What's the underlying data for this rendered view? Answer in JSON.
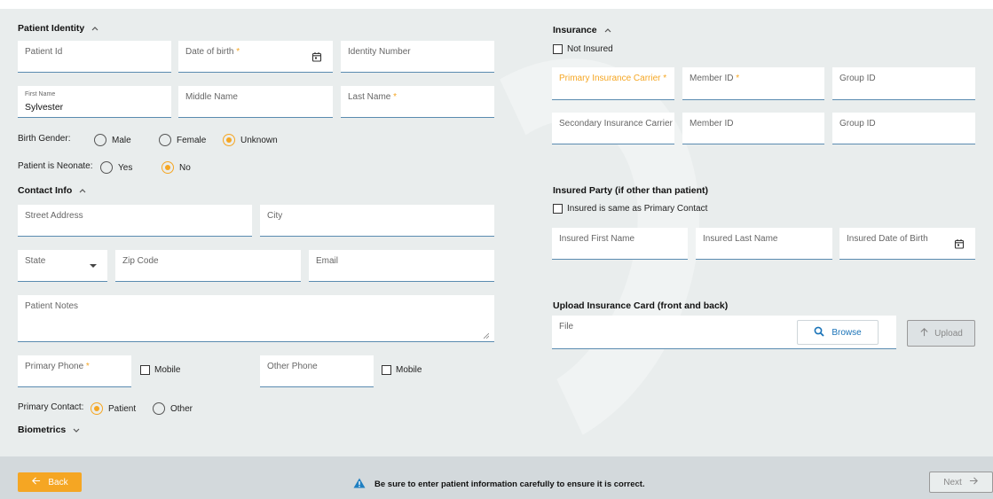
{
  "patient_identity": {
    "title": "Patient Identity",
    "patient_id_label": "Patient Id",
    "dob_label": "Date of birth",
    "identity_number_label": "Identity Number",
    "first_name_label": "First Name",
    "first_name_value": "Sylvester",
    "middle_name_label": "Middle Name",
    "last_name_label": "Last Name",
    "birth_gender_label": "Birth Gender:",
    "gender_options": [
      "Male",
      "Female",
      "Unknown"
    ],
    "gender_selected": "Unknown",
    "neonate_label": "Patient is Neonate:",
    "neonate_options": [
      "Yes",
      "No"
    ],
    "neonate_selected": "No"
  },
  "contact_info": {
    "title": "Contact Info",
    "street_label": "Street Address",
    "city_label": "City",
    "state_label": "State",
    "zip_label": "Zip Code",
    "email_label": "Email",
    "notes_label": "Patient Notes",
    "primary_phone_label": "Primary Phone",
    "mobile_label": "Mobile",
    "other_phone_label": "Other Phone",
    "mobile2_label": "Mobile",
    "primary_contact_label": "Primary Contact:",
    "primary_contact_options": [
      "Patient",
      "Other"
    ],
    "primary_contact_selected": "Patient"
  },
  "biometrics": {
    "title": "Biometrics"
  },
  "insurance": {
    "title": "Insurance",
    "not_insured_label": "Not Insured",
    "primary_carrier_label": "Primary Insurance Carrier",
    "member_id_label": "Member ID",
    "group_id_label": "Group ID",
    "secondary_carrier_label": "Secondary Insurance Carrier",
    "member_id2_label": "Member ID",
    "group_id2_label": "Group ID"
  },
  "insured_party": {
    "title": "Insured Party (if other than patient)",
    "same_as_label": "Insured is same as Primary Contact",
    "first_name_label": "Insured First Name",
    "last_name_label": "Insured Last Name",
    "dob_label": "Insured Date of Birth"
  },
  "upload": {
    "title": "Upload Insurance Card (front and back)",
    "file_label": "File",
    "browse_label": "Browse",
    "upload_label": "Upload"
  },
  "footer": {
    "back_label": "Back",
    "next_label": "Next",
    "warning_text": "Be sure to enter patient information carefully to ensure it is correct."
  },
  "required_mark": "*",
  "colors": {
    "accent": "#f5a623",
    "field_border": "#5a8bb0",
    "link": "#1a73b8",
    "warning_icon": "#1f7fc1"
  }
}
